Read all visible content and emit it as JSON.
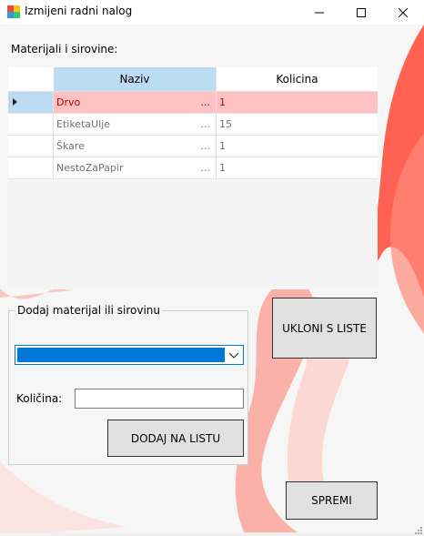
{
  "window": {
    "title": "Izmijeni radni nalog",
    "minimize_glyph": "—",
    "maximize_glyph": "☐",
    "close_glyph": "✕"
  },
  "materials": {
    "label": "Materijali i sirovine:",
    "columns": [
      "Naziv",
      "Kolicina"
    ],
    "rows": [
      {
        "naziv": "Drvo",
        "kolicina": "1",
        "dots": "...",
        "selected": true
      },
      {
        "naziv": "EtiketaUlje",
        "kolicina": "15",
        "dots": "..."
      },
      {
        "naziv": "Škare",
        "kolicina": "1",
        "dots": "..."
      },
      {
        "naziv": "NestoZaPapir",
        "kolicina": "1",
        "dots": "..."
      }
    ]
  },
  "buttons": {
    "remove": "UKLONI S LISTE",
    "add": "DODAJ NA LISTU",
    "save": "SPREMI"
  },
  "add_group": {
    "title": "Dodaj materijal ili sirovinu",
    "combo_value": "",
    "quantity_label": "Količina:",
    "quantity_value": ""
  },
  "colors": {
    "accent": "#0078d7",
    "selected_row": "#ffc2c2",
    "header_highlight": "#bcdcf4",
    "background_shape": "#ff5a4a"
  },
  "icons": [
    "app-icon",
    "minimize-icon",
    "maximize-icon",
    "close-icon",
    "row-pointer-icon",
    "chevron-down-icon",
    "resize-grip-icon"
  ]
}
